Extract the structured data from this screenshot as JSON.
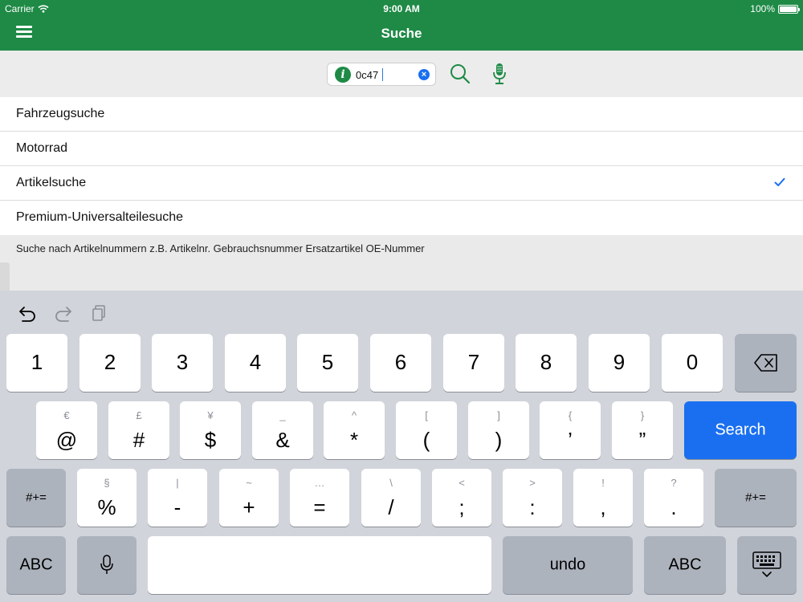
{
  "status": {
    "carrier": "Carrier",
    "time": "9:00 AM",
    "battery": "100%"
  },
  "nav": {
    "title": "Suche"
  },
  "search": {
    "value": "0c47"
  },
  "list": [
    {
      "label": "Fahrzeugsuche",
      "checked": false
    },
    {
      "label": "Motorrad",
      "checked": false
    },
    {
      "label": "Artikelsuche",
      "checked": true
    },
    {
      "label": "Premium-Universalteilesuche",
      "checked": false
    }
  ],
  "description": "Suche nach Artikelnummern z.B. Artikelnr. Gebrauchsnummer Ersatzartikel OE-Nummer",
  "colors": {
    "brand": "#1e8a46",
    "accent": "#1a6ff0"
  },
  "keyboard": {
    "row1": [
      "1",
      "2",
      "3",
      "4",
      "5",
      "6",
      "7",
      "8",
      "9",
      "0"
    ],
    "row2": [
      {
        "main": "@",
        "sub": "€"
      },
      {
        "main": "#",
        "sub": "£"
      },
      {
        "main": "$",
        "sub": "¥"
      },
      {
        "main": "&",
        "sub": "_"
      },
      {
        "main": "*",
        "sub": "^"
      },
      {
        "main": "(",
        "sub": "["
      },
      {
        "main": ")",
        "sub": "]"
      },
      {
        "main": "’",
        "sub": "{"
      },
      {
        "main": "”",
        "sub": "}"
      }
    ],
    "row3": [
      {
        "main": "%",
        "sub": "§"
      },
      {
        "main": "-",
        "sub": "|"
      },
      {
        "main": "+",
        "sub": "~"
      },
      {
        "main": "=",
        "sub": "…"
      },
      {
        "main": "/",
        "sub": "\\"
      },
      {
        "main": ";",
        "sub": "<"
      },
      {
        "main": ":",
        "sub": ">"
      },
      {
        "main": ",",
        "sub": "!"
      },
      {
        "main": ".",
        "sub": "?"
      }
    ],
    "search_label": "Search",
    "symbols_label": "#+=",
    "abc_label": "ABC",
    "undo_label": "undo",
    "icons": [
      "undo-icon",
      "redo-icon",
      "paste-icon",
      "delete-icon",
      "mic-icon",
      "keyboard-dismiss-icon"
    ]
  }
}
